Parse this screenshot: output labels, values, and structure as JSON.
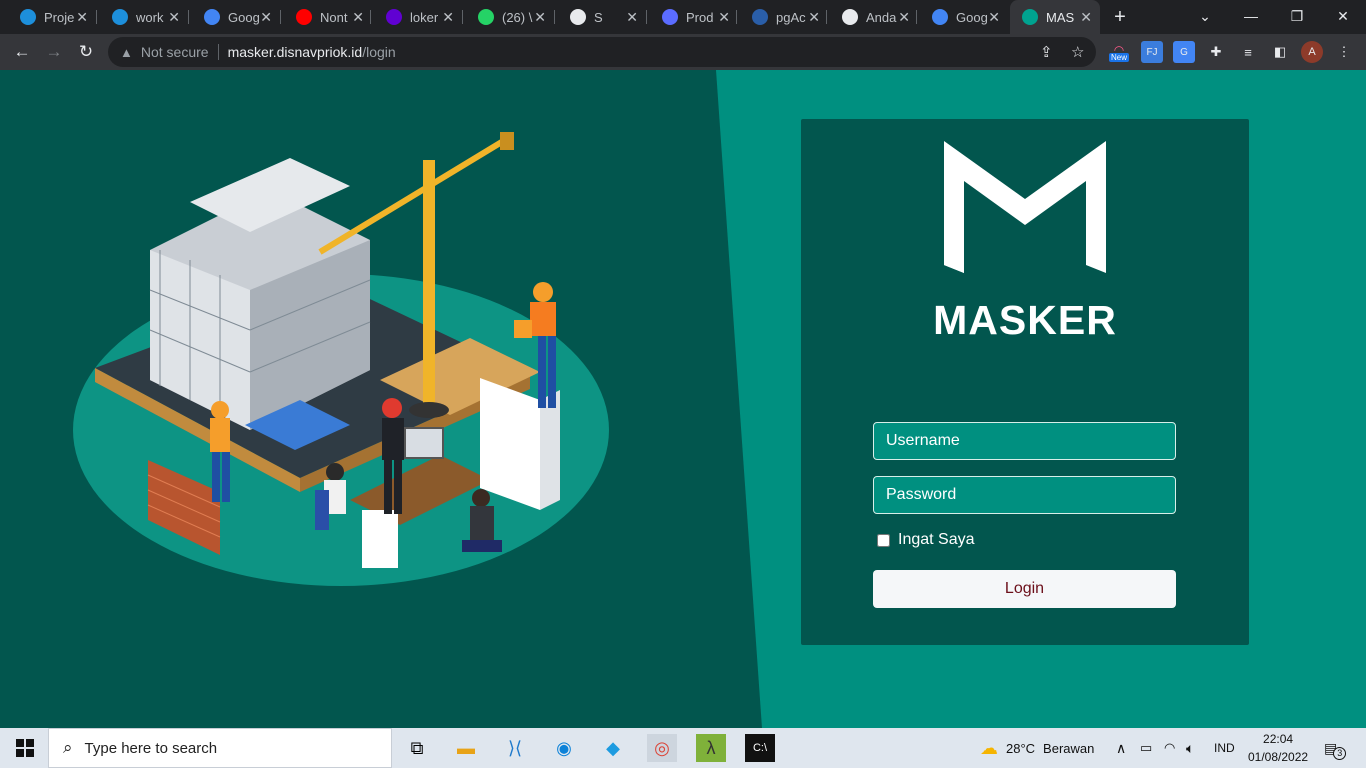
{
  "browser": {
    "tabs": [
      {
        "title": "Proje",
        "icon": "canva-icon",
        "color": "#1d8fdb"
      },
      {
        "title": "work",
        "icon": "canva-icon",
        "color": "#1d8fdb"
      },
      {
        "title": "Goog",
        "icon": "google-translate-icon",
        "color": "#4285f4"
      },
      {
        "title": "Nont",
        "icon": "youtube-icon",
        "color": "#ff0000"
      },
      {
        "title": "loker",
        "icon": "yahoo-icon",
        "color": "#6001d2"
      },
      {
        "title": "(26) \\",
        "icon": "whatsapp-icon",
        "color": "#25d366"
      },
      {
        "title": "S",
        "icon": "globe-icon",
        "color": "#e8eaed"
      },
      {
        "title": "Prod",
        "icon": "stripes-icon",
        "color": "#5b6cff"
      },
      {
        "title": "pgAc",
        "icon": "pgadmin-icon",
        "color": "#2a5ea8"
      },
      {
        "title": "Anda",
        "icon": "globe-icon",
        "color": "#e8eaed"
      },
      {
        "title": "Goog",
        "icon": "google-translate-icon",
        "color": "#4285f4"
      },
      {
        "title": "MAS",
        "icon": "masker-icon",
        "color": "#00a390"
      }
    ],
    "new_tab": "+",
    "url": {
      "security": "Not secure",
      "host": "masker.disnavpriok.id",
      "path": "/login"
    },
    "extension_badge": "New",
    "profile_initial": "A"
  },
  "login": {
    "brand": "MASKER",
    "username_placeholder": "Username",
    "password_placeholder": "Password",
    "remember_label": "Ingat Saya",
    "login_button": "Login"
  },
  "colors": {
    "page_bg": "#009080",
    "panel_bg": "#02564e",
    "button_text": "#6b0f1a"
  },
  "taskbar": {
    "search_placeholder": "Type here to search",
    "weather_temp": "28°C",
    "weather_text": "Berawan",
    "language": "IND",
    "time": "22:04",
    "date": "01/08/2022",
    "notification_count": "3"
  }
}
